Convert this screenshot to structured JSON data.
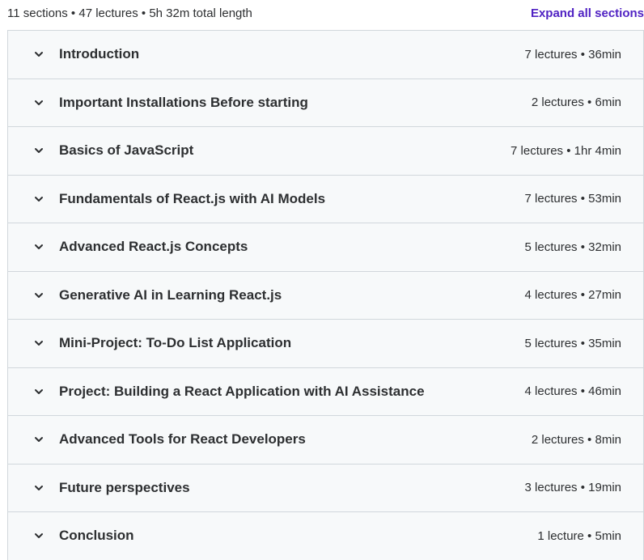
{
  "summary": {
    "text": "11 sections • 47 lectures • 5h 32m total length",
    "expand_label": "Expand all sections"
  },
  "colors": {
    "accent": "#5022c3",
    "row_bg": "#f7f9fa",
    "border": "#d1d7dc",
    "text": "#2d2f31"
  },
  "sections": [
    {
      "title": "Introduction",
      "meta": "7 lectures • 36min",
      "icon": "chevron-down-icon"
    },
    {
      "title": "Important Installations Before starting",
      "meta": "2 lectures • 6min",
      "icon": "chevron-down-icon"
    },
    {
      "title": "Basics of JavaScript",
      "meta": "7 lectures • 1hr 4min",
      "icon": "chevron-down-icon"
    },
    {
      "title": "Fundamentals of React.js with AI Models",
      "meta": "7 lectures • 53min",
      "icon": "chevron-down-icon"
    },
    {
      "title": "Advanced React.js Concepts",
      "meta": "5 lectures • 32min",
      "icon": "chevron-down-icon"
    },
    {
      "title": "Generative AI in Learning React.js",
      "meta": "4 lectures • 27min",
      "icon": "chevron-down-icon"
    },
    {
      "title": "Mini-Project: To-Do List Application",
      "meta": "5 lectures • 35min",
      "icon": "chevron-down-icon"
    },
    {
      "title": "Project: Building a React Application with AI Assistance",
      "meta": "4 lectures • 46min",
      "icon": "chevron-down-icon"
    },
    {
      "title": "Advanced Tools for React Developers",
      "meta": "2 lectures • 8min",
      "icon": "chevron-down-icon"
    },
    {
      "title": "Future perspectives",
      "meta": "3 lectures • 19min",
      "icon": "chevron-down-icon"
    },
    {
      "title": "Conclusion",
      "meta": "1 lecture • 5min",
      "icon": "chevron-down-icon"
    }
  ]
}
